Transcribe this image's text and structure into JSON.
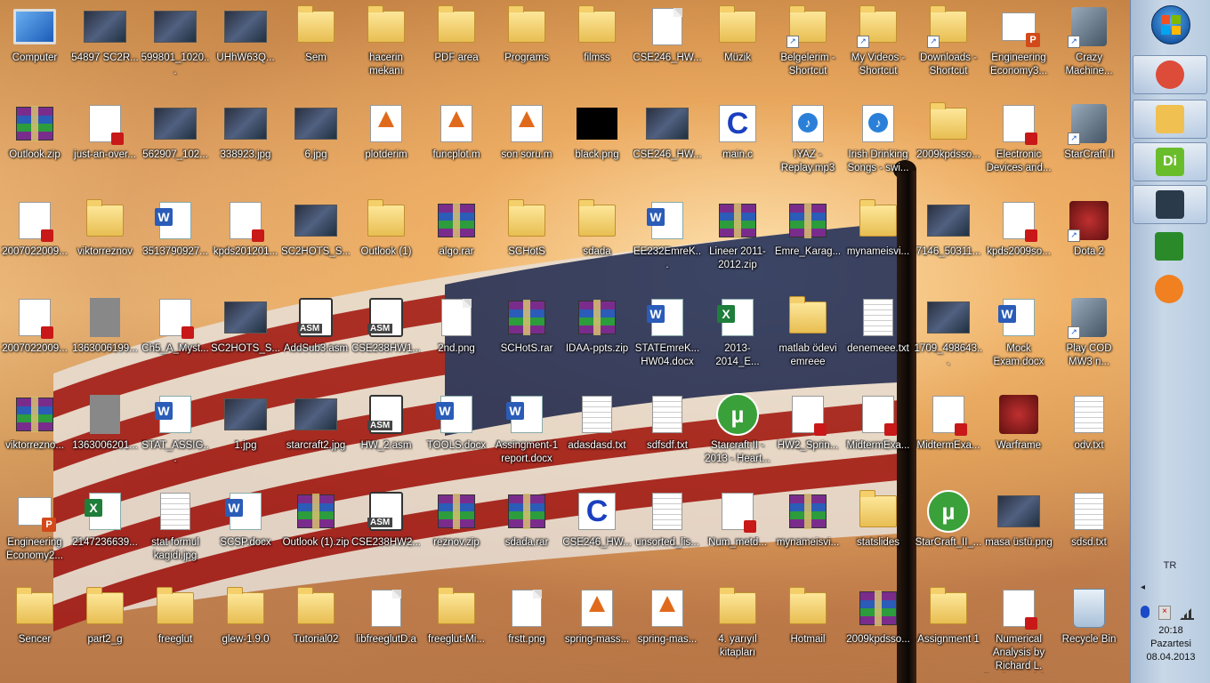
{
  "desktop": {
    "icons": [
      {
        "label": "Computer",
        "type": "computer"
      },
      {
        "label": "54897 SC2R...",
        "type": "img"
      },
      {
        "label": "599801_1020...",
        "type": "img"
      },
      {
        "label": "UHhW63Q...",
        "type": "img"
      },
      {
        "label": "Sem",
        "type": "folder"
      },
      {
        "label": "hacerin mekanı",
        "type": "folder"
      },
      {
        "label": "PDF area",
        "type": "folder"
      },
      {
        "label": "Programs",
        "type": "folder"
      },
      {
        "label": "filmss",
        "type": "folder"
      },
      {
        "label": "CSE246_HW...",
        "type": "doc"
      },
      {
        "label": "Müzik",
        "type": "folder"
      },
      {
        "label": "Belgelerim - Shortcut",
        "type": "folder",
        "shortcut": true
      },
      {
        "label": "My Videos - Shortcut",
        "type": "folder",
        "shortcut": true
      },
      {
        "label": "Downloads - Shortcut",
        "type": "folder",
        "shortcut": true
      },
      {
        "label": "Engineering Economy3...",
        "type": "pp"
      },
      {
        "label": "Crazy Machine...",
        "type": "exe",
        "shortcut": true
      },
      {
        "label": "Outlook.zip",
        "type": "rar"
      },
      {
        "label": "just-an-over...",
        "type": "pdf"
      },
      {
        "label": "562907_102...",
        "type": "img"
      },
      {
        "label": "338923.jpg",
        "type": "img"
      },
      {
        "label": "6.jpg",
        "type": "img"
      },
      {
        "label": "plotderim",
        "type": "matlab"
      },
      {
        "label": "funcplot.m",
        "type": "matlab"
      },
      {
        "label": "son soru.m",
        "type": "matlab"
      },
      {
        "label": "black.png",
        "type": "black"
      },
      {
        "label": "CSE246_HW...",
        "type": "img"
      },
      {
        "label": "main.c",
        "type": "c"
      },
      {
        "label": "IYAZ - Replay.mp3",
        "type": "media"
      },
      {
        "label": "Irish Drinking Songs - swi...",
        "type": "media"
      },
      {
        "label": "2009kpdsso...",
        "type": "folder"
      },
      {
        "label": "Electronic Devices and...",
        "type": "pdf"
      },
      {
        "label": "StarCraft II",
        "type": "exe",
        "shortcut": true
      },
      {
        "label": "2007022009...",
        "type": "pdf"
      },
      {
        "label": "viktorreznov",
        "type": "folder"
      },
      {
        "label": "3513790927...",
        "type": "word"
      },
      {
        "label": "kpds201201...",
        "type": "pdf"
      },
      {
        "label": "SC2HOTS_S...",
        "type": "img"
      },
      {
        "label": "Outlook (1)",
        "type": "folder"
      },
      {
        "label": "algo.rar",
        "type": "rar"
      },
      {
        "label": "SCHotS",
        "type": "folder"
      },
      {
        "label": "sdada",
        "type": "folder"
      },
      {
        "label": "EE232EmreK...",
        "type": "word"
      },
      {
        "label": "Lineer 2011-2012.zip",
        "type": "rar"
      },
      {
        "label": "Emre_Karag...",
        "type": "rar"
      },
      {
        "label": "mynameisvi...",
        "type": "folder"
      },
      {
        "label": "7146_50311...",
        "type": "img"
      },
      {
        "label": "kpds2009so...",
        "type": "pdf"
      },
      {
        "label": "Dota 2",
        "type": "game",
        "shortcut": true
      },
      {
        "label": "2007022009...",
        "type": "pdf"
      },
      {
        "label": "1363006199...",
        "type": "gray"
      },
      {
        "label": "Ch5_A_Myst...",
        "type": "pdf"
      },
      {
        "label": "SC2HOTS_S...",
        "type": "img"
      },
      {
        "label": "AddSub3.asm",
        "type": "asm"
      },
      {
        "label": "CSE238HW1...",
        "type": "asm"
      },
      {
        "label": "2nd.png",
        "type": "doc"
      },
      {
        "label": "SCHotS.rar",
        "type": "rar"
      },
      {
        "label": "IDAA-ppts.zip",
        "type": "rar"
      },
      {
        "label": "STATEmreK... HW04.docx",
        "type": "word"
      },
      {
        "label": "2013-2014_E...",
        "type": "excel"
      },
      {
        "label": "matlab ödevi emreee",
        "type": "folder"
      },
      {
        "label": "denemeee.txt",
        "type": "txt"
      },
      {
        "label": "1709_498643...",
        "type": "img"
      },
      {
        "label": "Mock Exam.docx",
        "type": "word"
      },
      {
        "label": "Play COD MW3 n...",
        "type": "exe",
        "shortcut": true
      },
      {
        "label": "viktorrezno...",
        "type": "rar"
      },
      {
        "label": "1363006201...",
        "type": "gray"
      },
      {
        "label": "STAT_ASSIG...",
        "type": "word"
      },
      {
        "label": "1.jpg",
        "type": "img"
      },
      {
        "label": "starcraft2.jpg",
        "type": "img"
      },
      {
        "label": "HW_2.asm",
        "type": "asm"
      },
      {
        "label": "TOOLS.docx",
        "type": "word"
      },
      {
        "label": "Assingment-1 report.docx",
        "type": "word"
      },
      {
        "label": "adasdasd.txt",
        "type": "txt"
      },
      {
        "label": "sdfsdf.txt",
        "type": "txt"
      },
      {
        "label": "Starcraft II - 2013 - Heart...",
        "type": "torrent"
      },
      {
        "label": "HW2_Sprin...",
        "type": "pdf"
      },
      {
        "label": "MidtermExa...",
        "type": "pdf"
      },
      {
        "label": "MidtermExa...",
        "type": "pdf"
      },
      {
        "label": "Warframe",
        "type": "game"
      },
      {
        "label": "odv.txt",
        "type": "txt"
      },
      {
        "label": "Engineering Economy2...",
        "type": "pp"
      },
      {
        "label": "2147236639...",
        "type": "excel"
      },
      {
        "label": "stat formul kagidi.jpg",
        "type": "txt"
      },
      {
        "label": "SCSP.docx",
        "type": "word"
      },
      {
        "label": "Outlook (1).zip",
        "type": "rar"
      },
      {
        "label": "CSE238HW2...",
        "type": "asm"
      },
      {
        "label": "reznov.zip",
        "type": "rar"
      },
      {
        "label": "sdada.rar",
        "type": "rar"
      },
      {
        "label": "CSE246_HW...",
        "type": "c"
      },
      {
        "label": "unsorted_lis...",
        "type": "txt"
      },
      {
        "label": "Num_metd...",
        "type": "pdf"
      },
      {
        "label": "mynameisvi...",
        "type": "rar"
      },
      {
        "label": "statslides",
        "type": "folder"
      },
      {
        "label": "StarCraft_II_...",
        "type": "torrent"
      },
      {
        "label": "masa üstü.png",
        "type": "img"
      },
      {
        "label": "sdsd.txt",
        "type": "txt"
      },
      {
        "label": "Sencer",
        "type": "folder"
      },
      {
        "label": "part2_g",
        "type": "folder"
      },
      {
        "label": "freeglut",
        "type": "folder"
      },
      {
        "label": "glew-1.9.0",
        "type": "folder"
      },
      {
        "label": "Tutorial02",
        "type": "folder"
      },
      {
        "label": "libfreeglutD.a",
        "type": "doc"
      },
      {
        "label": "freeglut-Mi...",
        "type": "folder"
      },
      {
        "label": "frstt.png",
        "type": "doc"
      },
      {
        "label": "spring-mass...",
        "type": "matlab"
      },
      {
        "label": "spring-mas...",
        "type": "matlab"
      },
      {
        "label": "4. yarıyıl kitapları",
        "type": "folder"
      },
      {
        "label": "Hotmail",
        "type": "folder"
      },
      {
        "label": "2009kpdsso...",
        "type": "rar"
      },
      {
        "label": "Assignment 1",
        "type": "folder"
      },
      {
        "label": "Numerical Analysis by Richard L. Burden and J...",
        "type": "pdf"
      },
      {
        "label": "Recycle Bin",
        "type": "recycle"
      }
    ]
  },
  "taskbar": {
    "pinned": [
      {
        "name": "chrome-icon",
        "color": "#dd4b39"
      },
      {
        "name": "explorer-icon",
        "color": "#f0c050"
      },
      {
        "name": "dreamweaver-icon",
        "color": "#6abd2a",
        "text": "Di"
      },
      {
        "name": "steam-icon",
        "color": "#2a3a4a"
      },
      {
        "name": "windows-live-icon",
        "color": "#2a8a2a"
      },
      {
        "name": "messenger-icon",
        "color": "#f08020"
      }
    ],
    "language": "TR",
    "time": "20:18",
    "day": "Pazartesi",
    "date": "08.04.2013"
  }
}
